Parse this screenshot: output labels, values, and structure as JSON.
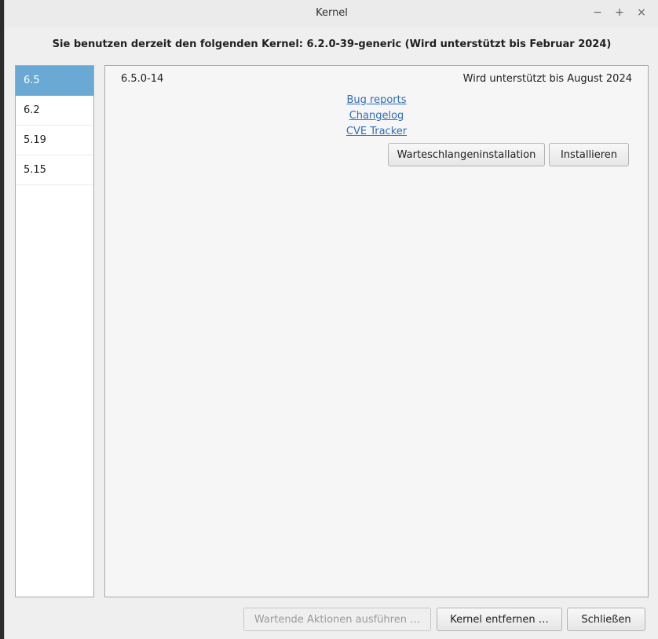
{
  "window": {
    "title": "Kernel",
    "controls": {
      "minimize": "−",
      "maximize": "+",
      "close": "×"
    }
  },
  "header": {
    "current_kernel": "Sie benutzen derzeit den folgenden Kernel: 6.2.0-39-generic (Wird unterstützt bis Februar 2024)"
  },
  "sidebar": {
    "items": [
      {
        "label": "6.5",
        "selected": true
      },
      {
        "label": "6.2",
        "selected": false
      },
      {
        "label": "5.19",
        "selected": false
      },
      {
        "label": "5.15",
        "selected": false
      }
    ]
  },
  "kernel": {
    "version": "6.5.0-14",
    "support": "Wird unterstützt bis August 2024",
    "links": [
      "Bug reports",
      "Changelog",
      "CVE Tracker"
    ],
    "queue_install_label": "Warteschlangeninstallation",
    "install_label": "Installieren"
  },
  "footer": {
    "run_pending_label": "Wartende Aktionen ausführen …",
    "remove_kernel_label": "Kernel entfernen …",
    "close_label": "Schließen"
  },
  "colors": {
    "selection": "#6aa9d3",
    "link": "#2f6db8"
  }
}
